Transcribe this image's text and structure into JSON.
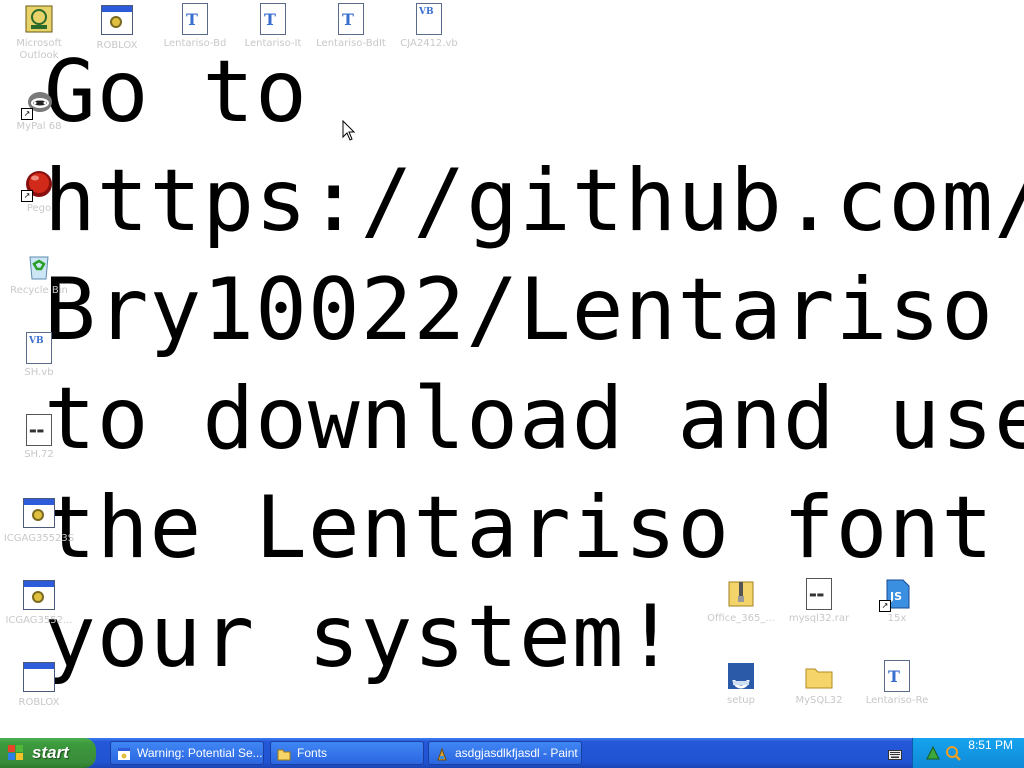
{
  "wallpaper": {
    "lines": [
      "Go to",
      "https://github.com/",
      "Bry10022/Lentariso",
      "to download and use",
      "the Lentariso font on",
      "your system!"
    ]
  },
  "icons": {
    "outlook": "Microsoft Outlook",
    "roblox_top": "ROBLOX",
    "lentariso_bd": "Lentariso-Bd",
    "lentariso_it": "Lentariso-It",
    "lentariso_bdit": "Lentariso-BdIt",
    "cja_vb": "CJA2412.vb",
    "mypal": "MyPal 68",
    "pego": "Pego",
    "recycle_bin": "Recycle Bin",
    "sh_vb": "SH.vb",
    "sh_72": "SH.72",
    "icgag_1": "ICGAG35523S",
    "icgag_2": "ICGAG3552...",
    "roblox_bottom": "ROBLOX",
    "office": "Office_365_...",
    "mysql_rar": "mysql32.rar",
    "fifteen": "15x",
    "setup": "setup",
    "mysql32": "MySQL32",
    "lentariso_re": "Lentariso-Re"
  },
  "taskbar": {
    "start_label": "start",
    "tasks": [
      "Warning: Potential Se...",
      "Fonts",
      "asdgjasdlkfjasdl - Paint"
    ],
    "clock": "8:51 PM"
  }
}
